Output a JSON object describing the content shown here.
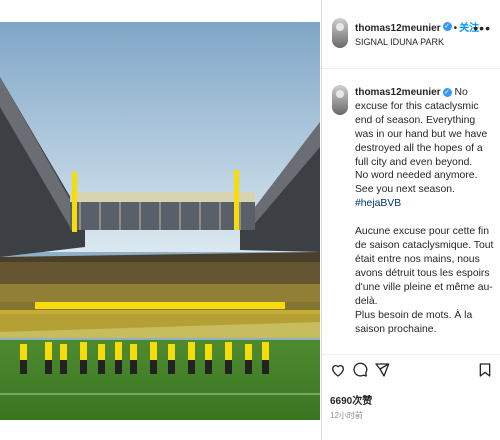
{
  "post": {
    "username": "thomas12meunier",
    "follow_label": "关注",
    "separator": "•",
    "location": "SIGNAL IDUNA PARK",
    "more_label": "•••",
    "caption": {
      "intro": "No excuse for this cataclysmic end of season. Everything was in our hand but we have destroyed all the hopes of a full city and even beyond.",
      "line2": "No word needed anymore. See you next season.",
      "hashtag": "#hejaBVB",
      "fr_intro": "Aucune excuse pour cette fin de saison cataclysmique. Tout était entre nos mains, nous avons détruit tous les espoirs d'une ville pleine et même au-delà.",
      "fr_line2": "Plus besoin de mots. À la saison prochaine."
    },
    "likes": "6690次赞",
    "time": "12小时前"
  },
  "icons": [
    "heart-icon",
    "comment-icon",
    "share-icon",
    "bookmark-icon",
    "more-icon",
    "verified-icon"
  ],
  "colors": {
    "follow": "#0095f6",
    "hashtag": "#00376b",
    "bvb_yellow": "#f5dc0a",
    "verified": "#3897f0"
  }
}
